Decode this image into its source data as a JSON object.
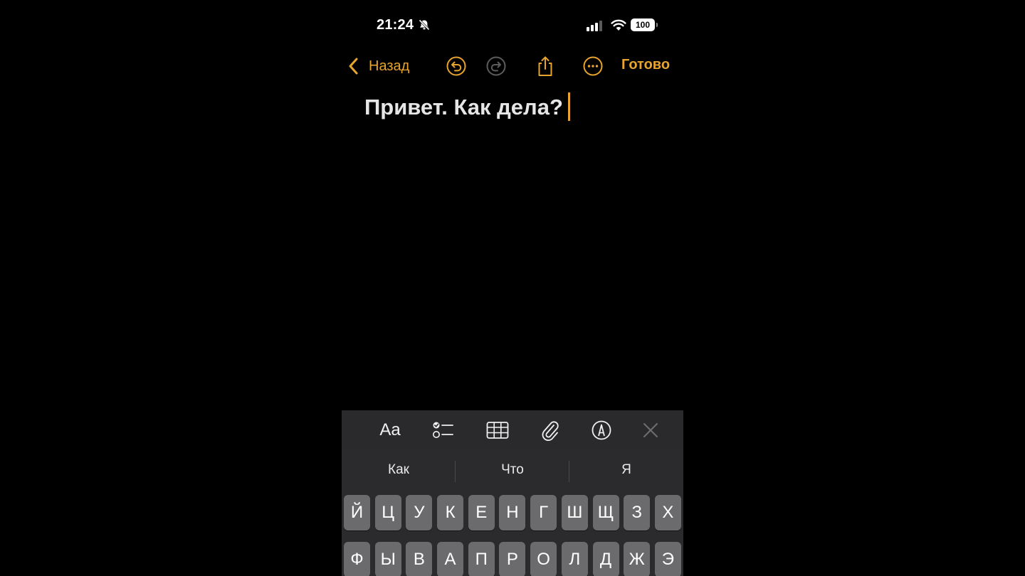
{
  "status_bar": {
    "time": "21:24",
    "battery": "100",
    "icons": [
      "bell-slash-icon",
      "cellular-signal-icon",
      "wifi-icon",
      "battery-icon"
    ]
  },
  "nav": {
    "back_label": "Назад",
    "done_label": "Готово",
    "icons": [
      "chevron-left-icon",
      "undo-icon",
      "redo-icon",
      "share-icon",
      "more-icon"
    ]
  },
  "note": {
    "text": "Привет. Как дела?"
  },
  "format_toolbar": {
    "text_style_label": "Aa",
    "icons": [
      "checklist-icon",
      "table-icon",
      "paperclip-icon",
      "markup-pen-icon",
      "close-icon"
    ]
  },
  "keyboard": {
    "suggestions": [
      "Как",
      "Что",
      "Я"
    ],
    "rows": [
      [
        "Й",
        "Ц",
        "У",
        "К",
        "Е",
        "Н",
        "Г",
        "Ш",
        "Щ",
        "З",
        "Х"
      ],
      [
        "Ф",
        "Ы",
        "В",
        "А",
        "П",
        "Р",
        "О",
        "Л",
        "Д",
        "Ж",
        "Э"
      ]
    ]
  },
  "colors": {
    "accent": "#e8a42c",
    "background": "#000000",
    "keyboard_bg": "#2b2b2d",
    "key_bg": "#6b6b6d"
  }
}
